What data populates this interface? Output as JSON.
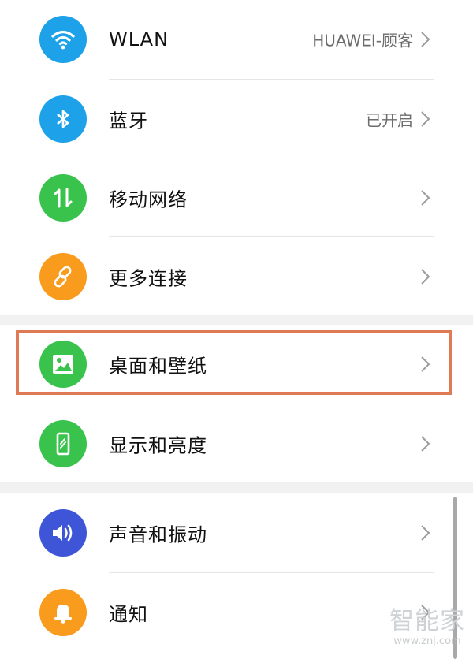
{
  "colors": {
    "wlan": "#1da2ea",
    "bluetooth": "#1da2ea",
    "mobile": "#39c34d",
    "more": "#f99b1d",
    "wallpaper": "#39c34d",
    "display": "#39c34d",
    "sound": "#3d55d6",
    "notify": "#f99b1d",
    "highlight": "#e07a55"
  },
  "rows": [
    {
      "label": "WLAN",
      "value": "HUAWEI-顾客",
      "icon": "wifi-icon"
    },
    {
      "label": "蓝牙",
      "value": "已开启",
      "icon": "bluetooth-icon"
    },
    {
      "label": "移动网络",
      "value": "",
      "icon": "mobile-data-icon"
    },
    {
      "label": "更多连接",
      "value": "",
      "icon": "link-icon"
    },
    {
      "label": "桌面和壁纸",
      "value": "",
      "icon": "wallpaper-icon"
    },
    {
      "label": "显示和亮度",
      "value": "",
      "icon": "display-icon"
    },
    {
      "label": "声音和振动",
      "value": "",
      "icon": "speaker-icon"
    },
    {
      "label": "通知",
      "value": "",
      "icon": "bell-icon"
    }
  ],
  "watermark": {
    "title": "智能家",
    "url": "www.znj.com"
  }
}
